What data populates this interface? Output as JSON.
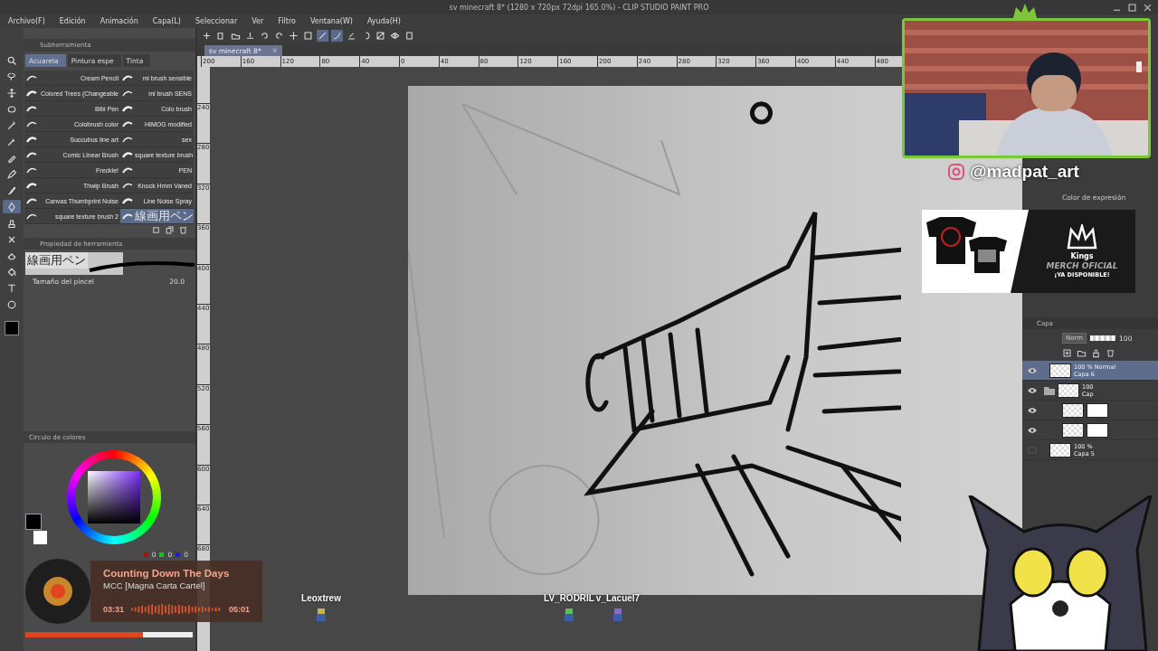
{
  "window": {
    "title": "sv minecraft 8* (1280 x 720px 72dpi 165.0%)  - CLIP STUDIO PAINT PRO"
  },
  "menu": [
    "Archivo(F)",
    "Edición",
    "Animación",
    "Capa(L)",
    "Seleccionar",
    "Ver",
    "Filtro",
    "Ventana(W)",
    "Ayuda(H)"
  ],
  "toolbar": [
    {
      "selected": false
    },
    {
      "selected": false
    },
    {
      "selected": false
    },
    {
      "selected": false
    },
    {
      "selected": false
    },
    {
      "selected": false
    },
    {
      "selected": false
    },
    {
      "selected": false
    },
    {
      "selected": true
    },
    {
      "selected": true
    },
    {
      "selected": false
    },
    {
      "selected": false
    },
    {
      "selected": false
    },
    {
      "selected": false
    },
    {
      "selected": false
    }
  ],
  "document_tab": {
    "label": "sv minecraft 8*",
    "close": "×"
  },
  "ruler_h": [
    "200",
    "160",
    "120",
    "80",
    "40",
    "0",
    "40",
    "80",
    "120",
    "160",
    "200",
    "240",
    "280",
    "320",
    "360",
    "400",
    "440",
    "480"
  ],
  "ruler_v": [
    "240",
    "280",
    "320",
    "360",
    "400",
    "440",
    "480",
    "520",
    "560",
    "600",
    "640",
    "680"
  ],
  "tools": [
    {
      "selected": false
    },
    {
      "selected": false
    },
    {
      "selected": false
    },
    {
      "selected": false
    },
    {
      "selected": false
    },
    {
      "selected": false
    },
    {
      "selected": false
    },
    {
      "selected": false
    },
    {
      "selected": false
    },
    {
      "selected": true
    },
    {
      "selected": false
    },
    {
      "selected": false
    },
    {
      "selected": false
    },
    {
      "selected": false
    },
    {
      "selected": false
    },
    {
      "selected": false
    }
  ],
  "sub_tool": {
    "title": "Subherramienta",
    "tabs": [
      {
        "label": "Acuarela",
        "selected": true
      },
      {
        "label": "Pintura espe",
        "selected": false
      },
      {
        "label": "Tinta",
        "selected": false
      }
    ],
    "brushes": [
      {
        "name": "Cream Pencil",
        "selected": false
      },
      {
        "name": "mi brush sensible",
        "selected": false
      },
      {
        "name": "Colored Trees (Changeable",
        "selected": false
      },
      {
        "name": "mi brush SENS",
        "selected": false
      },
      {
        "name": "Bibi Pen",
        "selected": false
      },
      {
        "name": "Colo brush",
        "selected": false
      },
      {
        "name": "Colobrush color",
        "selected": false
      },
      {
        "name": "HIMOG modified",
        "selected": false
      },
      {
        "name": "Succubus line art",
        "selected": false
      },
      {
        "name": "sex",
        "selected": false
      },
      {
        "name": "Comic Linear Brush",
        "selected": false
      },
      {
        "name": "square texture brush",
        "selected": false
      },
      {
        "name": "Freckle!",
        "selected": false
      },
      {
        "name": "PEN",
        "selected": false
      },
      {
        "name": "Thwip Brush",
        "selected": false
      },
      {
        "name": "Knock Hmm Vaned",
        "selected": false
      },
      {
        "name": "Canvas Thumbprint Noise",
        "selected": false
      },
      {
        "name": "Line Noise Spray",
        "selected": false
      },
      {
        "name": "square texture brush 2",
        "selected": false
      },
      {
        "name": "線画用ペン",
        "selected": true
      }
    ]
  },
  "tool_property": {
    "title": "Propiedad de herramienta",
    "brush": "線画用ペン",
    "size_label": "Tamaño del pincel",
    "size": "20.0"
  },
  "color_wheel": {
    "title": "Circulo de colores",
    "r": "0",
    "g": "0",
    "b": "0"
  },
  "right_panel": {
    "expression_label": "Color de expresión",
    "layer_title": "Capa",
    "blend": "Norm",
    "opacity": "100",
    "opacity_slider": {
      "level": 1
    },
    "layers": [
      {
        "visible": true,
        "kind": "layer",
        "text": "100 % Normal",
        "name": "Capa 6",
        "selected": true
      },
      {
        "visible": true,
        "kind": "folder",
        "text": "100",
        "name": "Cap",
        "selected": false
      },
      {
        "visible": true,
        "kind": "mask",
        "selected": false
      },
      {
        "visible": true,
        "kind": "mask",
        "selected": false
      },
      {
        "visible": false,
        "kind": "layer",
        "text": "100 %",
        "name": "Capa 5",
        "selected": false
      }
    ]
  },
  "overlay": {
    "handle": "@madpat_art",
    "merch": {
      "brand": "Kings",
      "title": "MERCH OFICIAL",
      "subtitle": "¡YA DISPONIBLE!"
    },
    "now_playing": {
      "title": "Counting Down The Days",
      "artist": "MCC [Magna Carta Cartel]",
      "elapsed": "03:31",
      "total": "05:01",
      "level": 0.7
    },
    "viewers": [
      "Leoxtrew",
      "LV_RODRIL",
      "v_Lacuel7"
    ]
  }
}
